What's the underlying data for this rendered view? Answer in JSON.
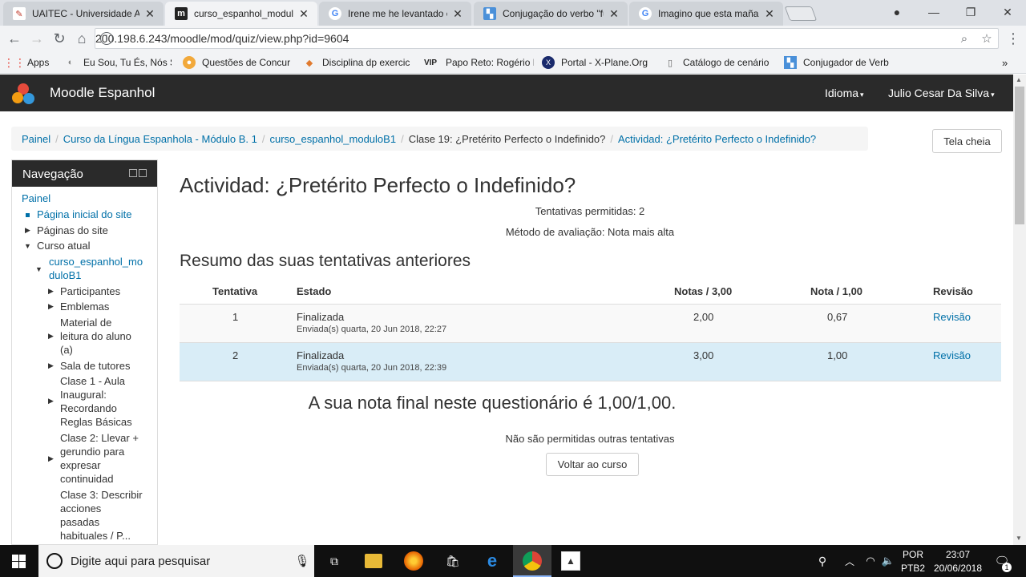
{
  "browser": {
    "tabs": [
      {
        "title": "UAITEC - Universidade Ab",
        "favicon": "uaitec-icon",
        "active": false
      },
      {
        "title": "curso_espanhol_moduloB",
        "favicon": "moodle-m-icon",
        "active": true
      },
      {
        "title": "Irene me he levantado ej",
        "favicon": "google-g-icon",
        "active": false
      },
      {
        "title": "Conjugação do verbo \"fu",
        "favicon": "conjugacao-icon",
        "active": false
      },
      {
        "title": "Imagino que esta mañana",
        "favicon": "google-g-icon",
        "active": false
      }
    ],
    "url": "200.198.6.243/moodle/mod/quiz/view.php?id=9604",
    "bookmarks": [
      {
        "label": "Apps"
      },
      {
        "label": "Eu Sou, Tu És, Nós S"
      },
      {
        "label": "Questões de Concur"
      },
      {
        "label": "Disciplina dp exercic"
      },
      {
        "label": "Papo Reto: Rogério F"
      },
      {
        "label": "Portal - X-Plane.Org"
      },
      {
        "label": "Catálogo de cenário"
      },
      {
        "label": "Conjugador de Verb"
      }
    ]
  },
  "moodle": {
    "site_name": "Moodle Espanhol",
    "language_menu": "Idioma",
    "user_menu": "Julio Cesar Da Silva",
    "breadcrumb": [
      "Painel",
      "Curso da Língua Espanhola - Módulo B. 1",
      "curso_espanhol_moduloB1",
      "Clase 19: ¿Pretérito Perfecto o Indefinido?",
      "Actividad: ¿Pretérito Perfecto o Indefinido?"
    ],
    "fullscreen_button": "Tela cheia",
    "nav": {
      "title": "Navegação",
      "items": [
        "Painel",
        "Página inicial do site",
        "Páginas do site",
        "Curso atual",
        "curso_espanhol_mo",
        "duloB1",
        "Participantes",
        "Emblemas",
        "Material de",
        "leitura do aluno",
        "(a)",
        "Sala de tutores",
        "Clase 1 - Aula",
        "Inaugural:",
        "Recordando",
        "Reglas Básicas",
        "Clase 2: Llevar +",
        "gerundio para",
        "expresar",
        "continuidad",
        "Clase 3: Describir",
        "acciones",
        "pasadas",
        "habituales / P..."
      ]
    },
    "quiz": {
      "title": "Actividad: ¿Pretérito Perfecto o Indefinido?",
      "attempts_allowed": "Tentativas permitidas: 2",
      "grading_method": "Método de avaliação: Nota mais alta",
      "summary_heading": "Resumo das suas tentativas anteriores",
      "columns": [
        "Tentativa",
        "Estado",
        "Notas / 3,00",
        "Nota / 1,00",
        "Revisão"
      ],
      "attempts": [
        {
          "num": "1",
          "state": "Finalizada",
          "submitted": "Enviada(s) quarta, 20 Jun 2018, 22:27",
          "marks": "2,00",
          "grade": "0,67",
          "review": "Revisão"
        },
        {
          "num": "2",
          "state": "Finalizada",
          "submitted": "Enviada(s) quarta, 20 Jun 2018, 22:39",
          "marks": "3,00",
          "grade": "1,00",
          "review": "Revisão"
        }
      ],
      "final_grade": "A sua nota final neste questionário é 1,00/1,00.",
      "no_more_attempts": "Não são permitidas outras tentativas",
      "back_button": "Voltar ao curso"
    }
  },
  "taskbar": {
    "search_placeholder": "Digite aqui para pesquisar",
    "lang_top": "POR",
    "lang_bottom": "PTB2",
    "time": "23:07",
    "date": "20/06/2018",
    "notification_count": "1"
  },
  "colors": {
    "header_bg": "#2a2a2a",
    "link": "#0070a8",
    "highlight_row": "#d9edf7"
  }
}
